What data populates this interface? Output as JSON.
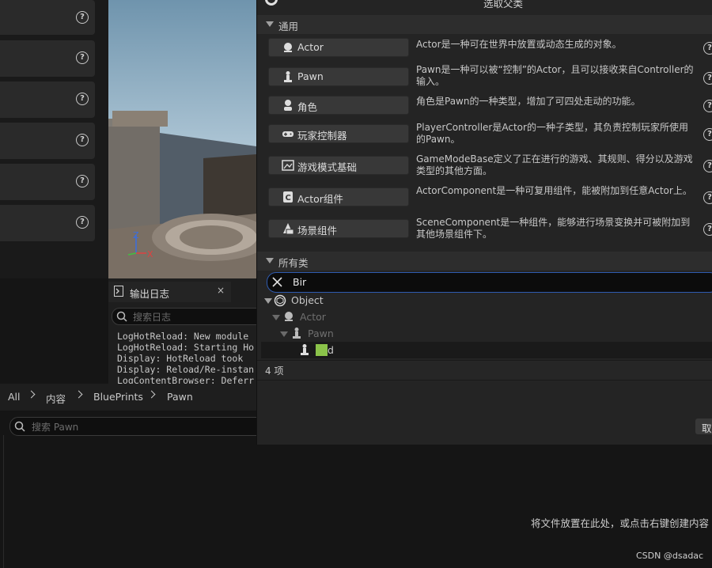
{
  "dialog": {
    "title": "选取父类",
    "common_section": "通用",
    "common_classes": [
      {
        "label": "Actor",
        "icon": "sphere-icon",
        "description": "Actor是一种可在世界中放置或动态生成的对象。"
      },
      {
        "label": "Pawn",
        "icon": "pawn-icon",
        "description": "Pawn是一种可以被“控制”的Actor，且可以接收来自Controller的输入。"
      },
      {
        "label": "角色",
        "icon": "character-icon",
        "description": "角色是Pawn的一种类型，增加了可四处走动的功能。"
      },
      {
        "label": "玩家控制器",
        "icon": "gamepad-icon",
        "description": "PlayerController是Actor的一种子类型，其负责控制玩家所使用的Pawn。"
      },
      {
        "label": "游戏模式基础",
        "icon": "image-icon",
        "description": "GameModeBase定义了正在进行的游戏、其规则、得分以及游戏类型的其他方面。"
      },
      {
        "label": "Actor组件",
        "icon": "component-icon",
        "description": "ActorComponent是一种可复用组件，能被附加到任意Actor上。"
      },
      {
        "label": "场景组件",
        "icon": "scene-component-icon",
        "description": "SceneComponent是一种组件，能够进行场景变换并可被附加到其他场景组件下。"
      }
    ],
    "all_classes_section": "所有类",
    "filter_value": "Bir",
    "tree": [
      {
        "label": "Object",
        "icon": "object-icon"
      },
      {
        "label": "Actor",
        "icon": "sphere-icon"
      },
      {
        "label": "Pawn",
        "icon": "pawn-icon"
      },
      {
        "label": "Bird",
        "highlight": "Bir",
        "rest": "d",
        "icon": "pawn-icon"
      }
    ],
    "count": "4 项",
    "cancel_label": "取"
  },
  "output_log": {
    "tab_label": "输出日志",
    "search_placeholder": "搜索日志",
    "lines": [
      "LogHotReload: New module",
      "LogHotReload: Starting Ho",
      "Display: HotReload took",
      "Display: Reload/Re-instan",
      "LogContentBrowser: Deferr"
    ]
  },
  "content_browser": {
    "breadcrumb": [
      "All",
      "内容",
      "BluePrints",
      "Pawn"
    ],
    "search_placeholder": "搜索 Pawn",
    "empty_hint": "将文件放置在此处，或点击右键创建内容",
    "watermark": "CSDN @dsadac"
  },
  "viewport": {
    "axis_z": "Z",
    "axis_x": "X"
  },
  "colors": {
    "accent": "#2f5bb0",
    "highlight": "#8bc34a"
  }
}
